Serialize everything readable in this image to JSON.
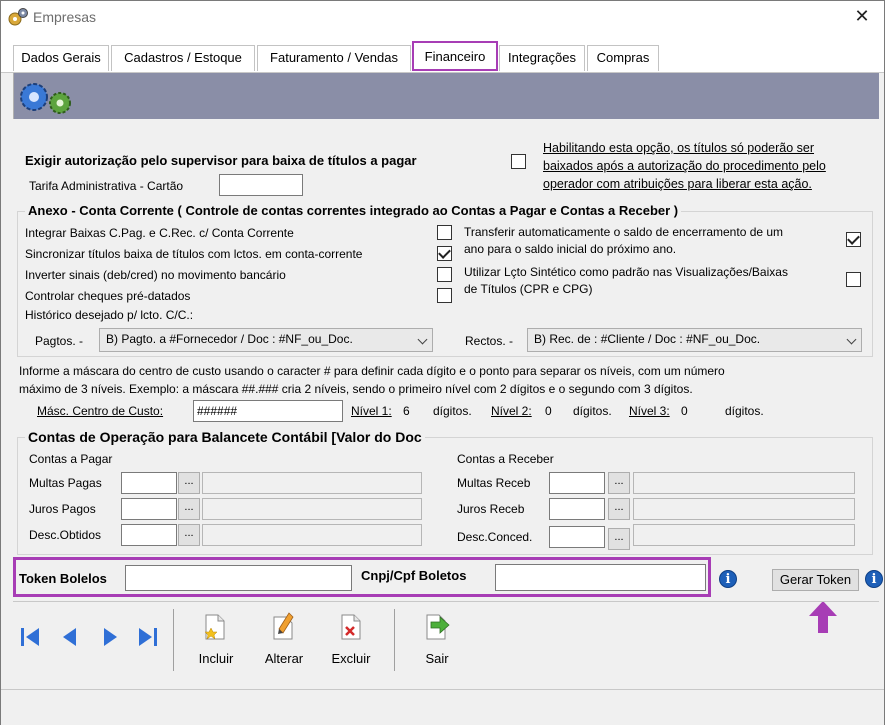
{
  "window": {
    "title": "Empresas",
    "close_glyph": "✕",
    "app_icon": "gears-app-icon"
  },
  "tabs": [
    {
      "label": "Dados Gerais"
    },
    {
      "label": "Cadastros / Estoque"
    },
    {
      "label": "Faturamento / Vendas"
    },
    {
      "label": "Financeiro",
      "active": true
    },
    {
      "label": "Integrações"
    },
    {
      "label": "Compras"
    }
  ],
  "supervisor": {
    "label": "Exigir autorização pelo supervisor para baixa de títulos a pagar",
    "checked": false,
    "hint_line1": "Habilitando esta opção, os títulos só poderão ser",
    "hint_line2": "baixados após a autorização do procedimento pelo",
    "hint_line3": "operador com atribuições para liberar esta ação."
  },
  "tarifa": {
    "label": "Tarifa Administrativa - Cartão",
    "value": ""
  },
  "anexo": {
    "title": "Anexo - Conta Corrente ( Controle de contas correntes integrado ao Contas a Pagar e Contas a Receber )",
    "opt_integrar": "Integrar Baixas C.Pag. e C.Rec. c/ Conta Corrente",
    "opt_sincronizar": "Sincronizar títulos baixa de títulos com lctos. em conta-corrente",
    "opt_inverter": "Inverter sinais (deb/cred) no movimento bancário",
    "opt_cheques": "Controlar cheques pré-datados",
    "opt_historico": "Histórico desejado p/ lcto. C/C.:",
    "opt_transferir_l1": "Transferir automaticamente o saldo de encerramento de um",
    "opt_transferir_l2": "ano para o saldo inicial do próximo ano.",
    "opt_sintetico_l1": "Utilizar Lçto Sintético como padrão nas Visualizações/Baixas",
    "opt_sintetico_l2": "de Títulos (CPR e CPG)",
    "pagtos_label": "Pagtos. -",
    "pagtos_value": "B) Pagto. a #Fornecedor / Doc : #NF_ou_Doc.",
    "rectos_label": "Rectos. -",
    "rectos_value": "B) Rec. de : #Cliente / Doc : #NF_ou_Doc."
  },
  "mascara": {
    "info_line1": "Informe a máscara do centro de custo usando o caracter # para definir cada dígito e o ponto para separar os níveis, com um número",
    "info_line2": "máximo de 3 níveis. Exemplo: a máscara ##.### cria 2 níveis, sendo o primeiro nível com 2 dígitos e o segundo com 3 dígitos.",
    "label": "Másc. Centro de Custo:",
    "value": "######",
    "nivel1_label": "Nível 1:",
    "nivel1_value": "6",
    "nivel2_label": "Nível 2:",
    "nivel2_value": "0",
    "nivel3_label": "Nível 3:",
    "nivel3_value": "0",
    "digitos": "dígitos."
  },
  "contas": {
    "title": "Contas de Operação para Balancete Contábil [Valor do Doc",
    "pagar_title": "Contas a Pagar",
    "receber_title": "Contas a Receber",
    "multas_pagas": "Multas Pagas",
    "juros_pagos": "Juros Pagos",
    "desc_obtidos": "Desc.Obtidos",
    "multas_receb": "Multas Receb",
    "juros_receb": "Juros Receb",
    "desc_conced": "Desc.Conced.",
    "dots": "..."
  },
  "token": {
    "label": "Token Bolelos",
    "value": "",
    "cnpj_label": "Cnpj/Cpf Boletos",
    "cnpj_value": "",
    "gerar_label": "Gerar Token",
    "info_glyph": "i"
  },
  "toolbar": {
    "incluir": "Incluir",
    "alterar": "Alterar",
    "excluir": "Excluir",
    "sair": "Sair"
  },
  "colors": {
    "highlight": "#a73db5",
    "banner": "#8a8ea7",
    "nav_blue": "#2f6fd6"
  }
}
